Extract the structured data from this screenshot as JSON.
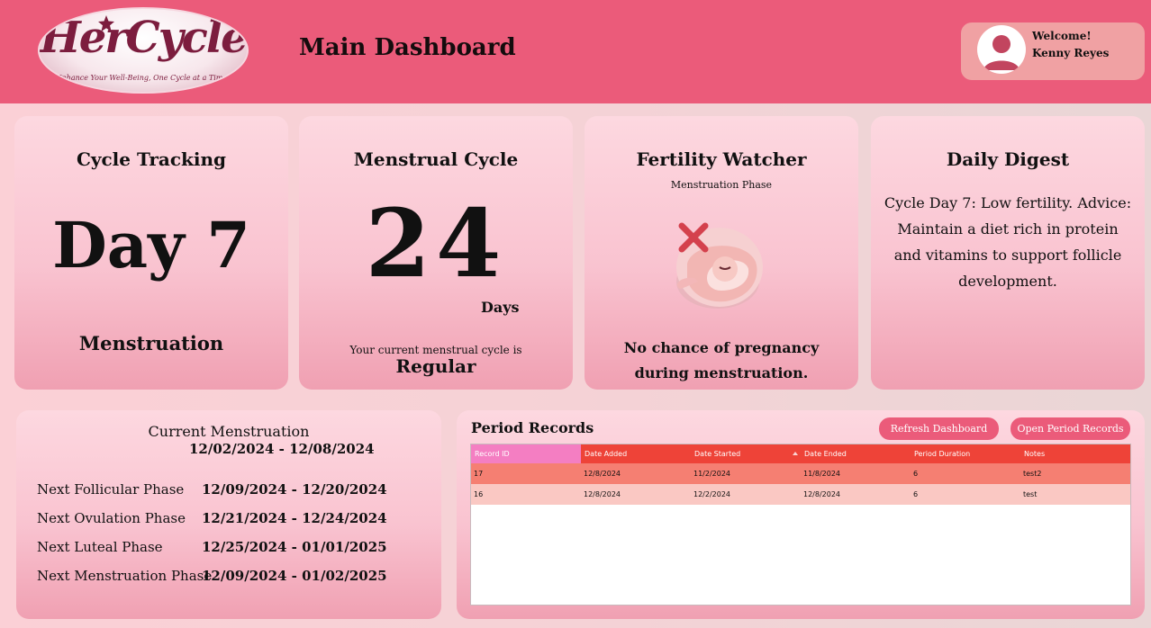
{
  "header": {
    "logo_title": "HerCycle",
    "logo_tagline": "Enhance Your Well-Being, One Cycle at a Time!",
    "page_title": "Main Dashboard",
    "welcome_label": "Welcome!",
    "user_name": "Kenny Reyes"
  },
  "cards": {
    "cycle_tracking": {
      "title": "Cycle Tracking",
      "day": "Day 7",
      "phase": "Menstruation"
    },
    "menstrual_cycle": {
      "title": "Menstrual Cycle",
      "length": "24",
      "unit": "Days",
      "caption": "Your current menstrual cycle is",
      "status": "Regular"
    },
    "fertility_watcher": {
      "title": "Fertility Watcher",
      "subtitle": "Menstruation Phase",
      "message": "No chance of pregnancy during menstruation."
    },
    "daily_digest": {
      "title": "Daily Digest",
      "text": "Cycle Day 7: Low fertility. Advice: Maintain a diet rich in protein and vitamins to support follicle development."
    }
  },
  "phases": {
    "current_label": "Current Menstruation",
    "current_range": "12/02/2024 - 12/08/2024",
    "rows": [
      {
        "name": "Next Follicular Phase",
        "range": "12/09/2024 - 12/20/2024"
      },
      {
        "name": "Next Ovulation Phase",
        "range": "12/21/2024 - 12/24/2024"
      },
      {
        "name": "Next Luteal Phase",
        "range": "12/25/2024 - 01/01/2025"
      },
      {
        "name": "Next Menstruation Phase",
        "range": "12/09/2024 - 01/02/2025"
      }
    ]
  },
  "records": {
    "title": "Period Records",
    "refresh_label": "Refresh Dashboard",
    "open_label": "Open Period Records",
    "columns": [
      "Record ID",
      "Date Added",
      "Date Started",
      "Date Ended",
      "Period Duration",
      "Notes"
    ],
    "rows": [
      [
        "17",
        "12/8/2024",
        "11/2/2024",
        "11/8/2024",
        "6",
        "test2"
      ],
      [
        "16",
        "12/8/2024",
        "12/2/2024",
        "12/8/2024",
        "6",
        "test"
      ]
    ]
  },
  "colors": {
    "header": "#eb5b7a",
    "button": "#eb5b7a",
    "grid_header": "#ee4338",
    "grid_header_selected": "#f47ec2",
    "row_selected": "#f57f72",
    "row_alt": "#fac8c3",
    "logo_text": "#7c1d3e"
  }
}
